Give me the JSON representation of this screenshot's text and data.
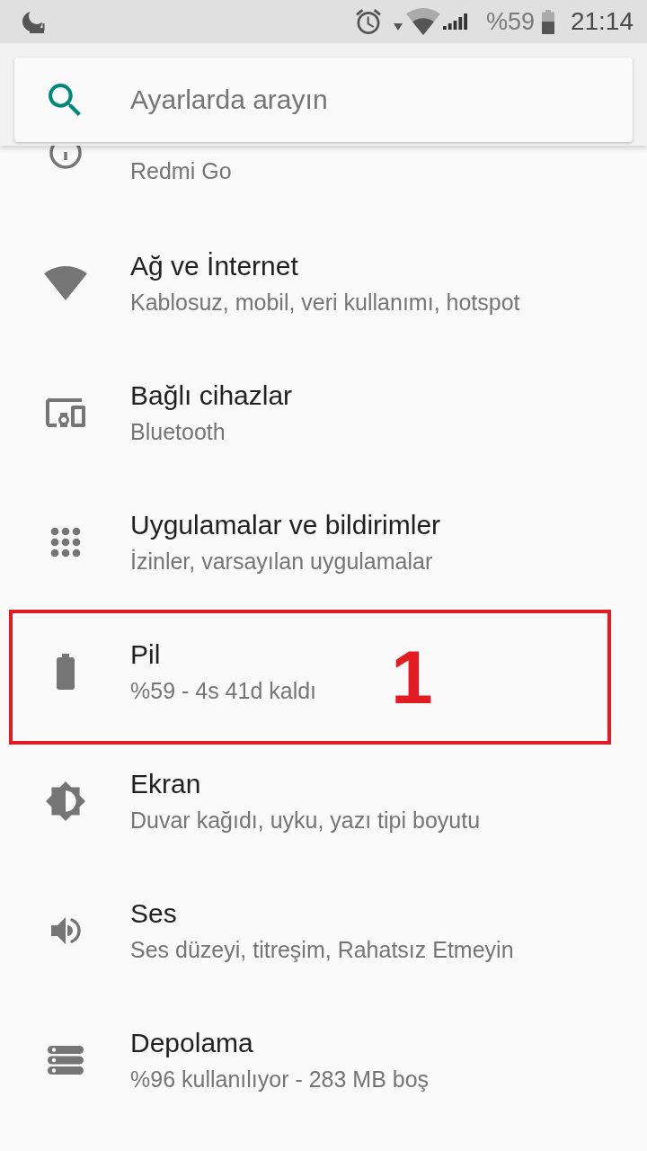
{
  "status_bar": {
    "battery_text": "%59",
    "time": "21:14"
  },
  "search": {
    "placeholder": "Ayarlarda arayın"
  },
  "settings": [
    {
      "kind": "device",
      "summary": "Redmi Go"
    },
    {
      "kind": "network",
      "title": "Ağ ve İnternet",
      "summary": "Kablosuz, mobil, veri kullanımı, hotspot"
    },
    {
      "kind": "devices",
      "title": "Bağlı cihazlar",
      "summary": "Bluetooth"
    },
    {
      "kind": "apps",
      "title": "Uygulamalar ve bildirimler",
      "summary": "İzinler, varsayılan uygulamalar"
    },
    {
      "kind": "battery",
      "title": "Pil",
      "summary": "%59 - 4s 41d kaldı",
      "annotation": {
        "label": "1"
      }
    },
    {
      "kind": "display",
      "title": "Ekran",
      "summary": "Duvar kağıdı, uyku, yazı tipi boyutu"
    },
    {
      "kind": "sound",
      "title": "Ses",
      "summary": "Ses düzeyi, titreşim, Rahatsız Etmeyin"
    },
    {
      "kind": "storage",
      "title": "Depolama",
      "summary": "%96 kullanılıyor - 283 MB boş"
    }
  ]
}
